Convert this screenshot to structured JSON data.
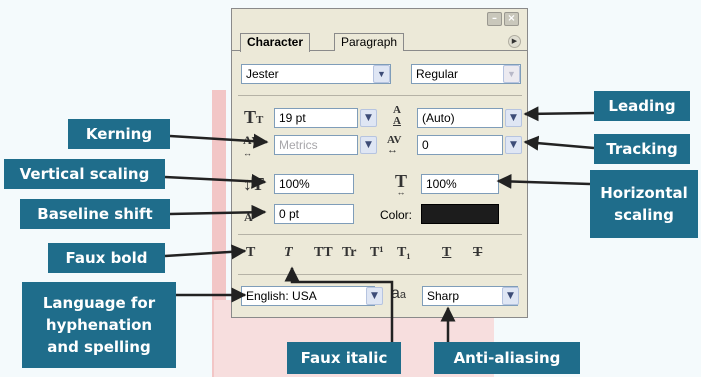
{
  "panel": {
    "tabs": [
      "Character",
      "Paragraph"
    ],
    "font_family": "Jester",
    "font_style": "Regular",
    "font_size": "19 pt",
    "leading": "(Auto)",
    "kerning": "Metrics",
    "tracking": "0",
    "vertical_scale": "100%",
    "horizontal_scale": "100%",
    "baseline_shift": "0 pt",
    "color_label": "Color:",
    "color_value": "#1c1c1c",
    "language": "English: USA",
    "antialias": "Sharp",
    "style_buttons": [
      "T",
      "T",
      "TT",
      "Tr",
      "T¹",
      "T₁",
      "T",
      "T"
    ],
    "icons": {
      "font_size": "font-size-icon",
      "leading": "leading-icon",
      "kerning": "kerning-icon",
      "tracking": "tracking-icon",
      "vertical_scale": "vertical-scale-icon",
      "horizontal_scale": "horizontal-scale-icon",
      "baseline_shift": "baseline-shift-icon",
      "antialias": "antialias-icon"
    }
  },
  "callouts": {
    "leading": "Leading",
    "kerning": "Kerning",
    "tracking": "Tracking",
    "vertical_scaling": "Vertical scaling",
    "horizontal_scaling_1": "Horizontal",
    "horizontal_scaling_2": "scaling",
    "baseline_shift": "Baseline shift",
    "faux_bold": "Faux bold",
    "language_1": "Language for",
    "language_2": "hyphenation",
    "language_3": "and spelling",
    "faux_italic": "Faux italic",
    "antialiasing": "Anti-aliasing"
  },
  "colors": {
    "callout_bg": "#1f6d8b",
    "panel_bg": "#ece9d8",
    "background": "#f4fafc"
  }
}
